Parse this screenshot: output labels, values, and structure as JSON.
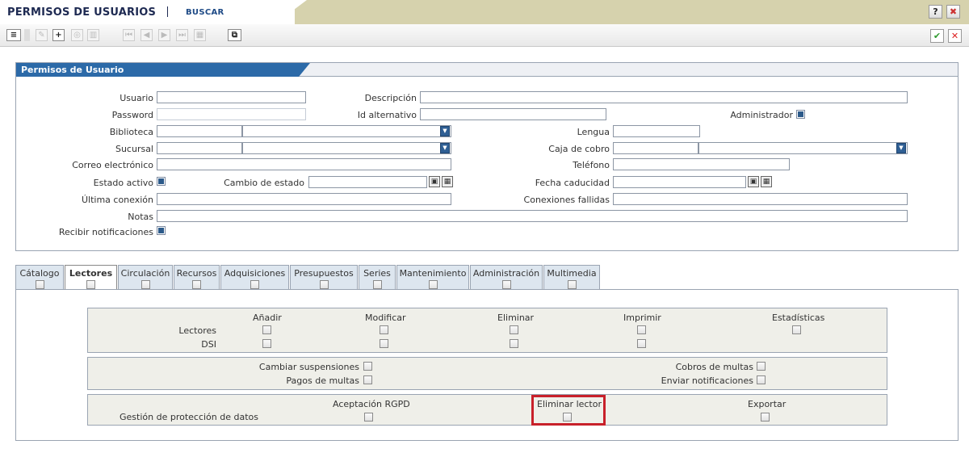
{
  "header": {
    "title": "PERMISOS DE USUARIOS",
    "subtitle": "BUSCAR",
    "help": "?",
    "close": "✖"
  },
  "toolbar": {
    "add": "+",
    "ok": "✔",
    "cancel": "✕"
  },
  "panel": {
    "title": "Permisos de Usuario",
    "labels": {
      "usuario": "Usuario",
      "descripcion": "Descripción",
      "password": "Password",
      "id_alternativo": "Id alternativo",
      "administrador": "Administrador",
      "biblioteca": "Biblioteca",
      "lengua": "Lengua",
      "sucursal": "Sucursal",
      "caja_cobro": "Caja de cobro",
      "correo": "Correo electrónico",
      "telefono": "Teléfono",
      "estado_activo": "Estado activo",
      "cambio_estado": "Cambio de estado",
      "fecha_caducidad": "Fecha caducidad",
      "ultima_conexion": "Última conexión",
      "conexiones_fallidas": "Conexiones fallidas",
      "notas": "Notas",
      "recibir_notificaciones": "Recibir notificaciones"
    }
  },
  "tabs": [
    "Cátalogo",
    "Lectores",
    "Circulación",
    "Recursos",
    "Adquisiciones",
    "Presupuestos",
    "Series",
    "Mantenimiento",
    "Administración",
    "Multimedia"
  ],
  "active_tab": "Lectores",
  "lectores": {
    "columns": [
      "Añadir",
      "Modificar",
      "Eliminar",
      "Imprimir",
      "Estadísticas"
    ],
    "rows": [
      "Lectores",
      "DSI"
    ],
    "extra_left": [
      "Cambiar suspensiones",
      "Pagos de multas"
    ],
    "extra_right": [
      "Cobros de multas",
      "Enviar notificaciones"
    ],
    "gdpr_label": "Gestión de protección de datos",
    "gdpr_cols": [
      "Aceptación RGPD",
      "Eliminar lector",
      "Exportar"
    ]
  }
}
